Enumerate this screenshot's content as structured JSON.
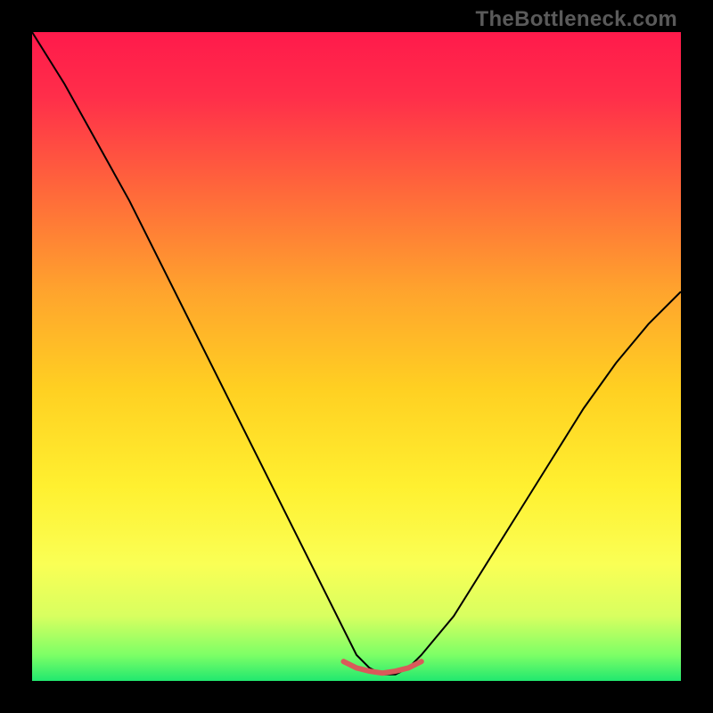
{
  "watermark": "TheBottleneck.com",
  "chart_data": {
    "type": "line",
    "title": "",
    "xlabel": "",
    "ylabel": "",
    "xlim": [
      0,
      100
    ],
    "ylim": [
      0,
      100
    ],
    "series": [
      {
        "name": "bottleneck-curve",
        "x": [
          0,
          5,
          10,
          15,
          20,
          25,
          30,
          35,
          40,
          45,
          48,
          50,
          52,
          54,
          56,
          58,
          60,
          65,
          70,
          75,
          80,
          85,
          90,
          95,
          100
        ],
        "y": [
          100,
          92,
          83,
          74,
          64,
          54,
          44,
          34,
          24,
          14,
          8,
          4,
          2,
          1,
          1,
          2,
          4,
          10,
          18,
          26,
          34,
          42,
          49,
          55,
          60
        ]
      },
      {
        "name": "bottleneck-floor-marker",
        "x": [
          48,
          50,
          52,
          54,
          56,
          58,
          60
        ],
        "y": [
          3,
          2,
          1.5,
          1.2,
          1.5,
          2,
          3
        ]
      }
    ],
    "gradient_stops": [
      {
        "offset": 0.0,
        "color": "#ff1a4b"
      },
      {
        "offset": 0.1,
        "color": "#ff2e4a"
      },
      {
        "offset": 0.25,
        "color": "#ff6a3a"
      },
      {
        "offset": 0.4,
        "color": "#ffa42d"
      },
      {
        "offset": 0.55,
        "color": "#ffd022"
      },
      {
        "offset": 0.7,
        "color": "#fff030"
      },
      {
        "offset": 0.82,
        "color": "#faff55"
      },
      {
        "offset": 0.9,
        "color": "#d8ff60"
      },
      {
        "offset": 0.96,
        "color": "#7dff66"
      },
      {
        "offset": 1.0,
        "color": "#21e86f"
      }
    ],
    "curve_stroke": "#000000",
    "curve_stroke_width": 2,
    "marker_color": "#d95a5a",
    "marker_stroke_width": 6
  }
}
